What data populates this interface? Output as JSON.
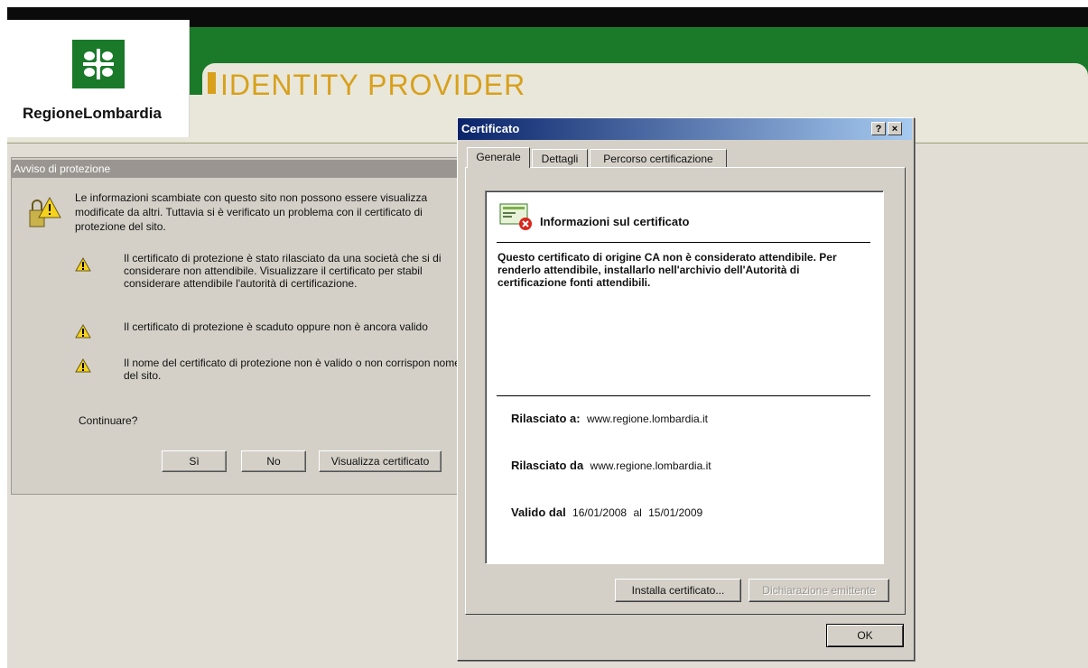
{
  "header": {
    "logo_text": "RegioneLombardia",
    "title": "IDENTITY PROVIDER"
  },
  "colors": {
    "brand_green": "#1a7a2a",
    "title_gold": "#d8a01c",
    "titlebar_blue": "#0a246a"
  },
  "security_dialog": {
    "title": "Avviso di protezione",
    "intro": "Le informazioni scambiate con questo sito non possono essere visualizza modificate da altri. Tuttavia si è verificato un problema con il certificato di protezione del sito.",
    "warnings": [
      "Il certificato di protezione è stato rilasciato da una società che si di considerare non attendibile. Visualizzare il certificato per stabil considerare attendibile l'autorità di certificazione.",
      "Il certificato di protezione è scaduto oppure non è ancora valido",
      "Il nome del certificato di protezione non è valido o non corrispon nome del sito."
    ],
    "question": "Continuare?",
    "buttons": {
      "yes": "Sì",
      "no": "No",
      "view": "Visualizza certificato"
    }
  },
  "cert_dialog": {
    "title": "Certificato",
    "help_button": "?",
    "close_button": "×",
    "tabs": [
      "Generale",
      "Dettagli",
      "Percorso certificazione"
    ],
    "info_title": "Informazioni sul certificato",
    "warning": "Questo certificato di origine CA non è considerato attendibile. Per renderlo attendibile, installarlo nell'archivio dell'Autorità di certificazione fonti attendibili.",
    "issued_to_label": "Rilasciato a:",
    "issued_to_value": "www.regione.lombardia.it",
    "issued_by_label": "Rilasciato da",
    "issued_by_value": "www.regione.lombardia.it",
    "valid_label": "Valido dal",
    "valid_from": "16/01/2008",
    "valid_sep": "al",
    "valid_to": "15/01/2009",
    "install_button": "Installa certificato...",
    "issuer_statement_button": "Dichiarazione emittente",
    "ok_button": "OK"
  }
}
